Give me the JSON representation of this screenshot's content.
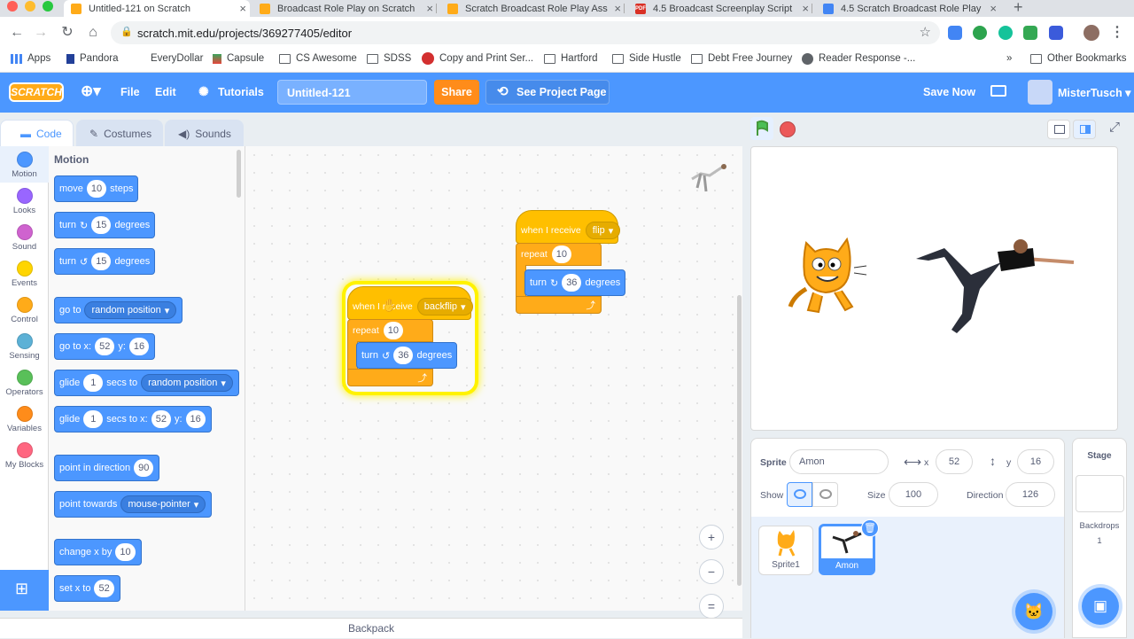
{
  "browser": {
    "tabs": [
      {
        "title": "Untitled-121 on Scratch"
      },
      {
        "title": "Broadcast Role Play on Scratch"
      },
      {
        "title": "Scratch Broadcast Role Play Ass"
      },
      {
        "title": "4.5 Broadcast Screenplay Script"
      },
      {
        "title": "4.5 Scratch Broadcast Role Play"
      }
    ],
    "tab_close": "×",
    "new_tab": "+",
    "url": "scratch.mit.edu/projects/369277405/editor",
    "bookmarks": [
      "Apps",
      "Pandora",
      "EveryDollar",
      "Capsule",
      "CS Awesome",
      "SDSS",
      "Copy and Print Ser...",
      "Hartford",
      "Side Hustle",
      "Debt Free Journey",
      "Reader Response -..."
    ],
    "other_bookmarks": "Other Bookmarks",
    "more": "»"
  },
  "menu": {
    "logo": "SCRATCH",
    "file": "File",
    "edit": "Edit",
    "tutorials": "Tutorials",
    "project_title": "Untitled-121",
    "share": "Share",
    "see_project": "See Project Page",
    "save_now": "Save Now",
    "username": "MisterTusch"
  },
  "editor_tabs": {
    "code": "Code",
    "costumes": "Costumes",
    "sounds": "Sounds"
  },
  "categories": [
    {
      "label": "Motion",
      "color": "#4c97ff"
    },
    {
      "label": "Looks",
      "color": "#9966ff"
    },
    {
      "label": "Sound",
      "color": "#cf63cf"
    },
    {
      "label": "Events",
      "color": "#ffd500"
    },
    {
      "label": "Control",
      "color": "#ffab19"
    },
    {
      "label": "Sensing",
      "color": "#5cb1d6"
    },
    {
      "label": "Operators",
      "color": "#59c059"
    },
    {
      "label": "Variables",
      "color": "#ff8c1a"
    },
    {
      "label": "My Blocks",
      "color": "#ff6680"
    }
  ],
  "palette": {
    "heading": "Motion",
    "move": {
      "pre": "move",
      "val": "10",
      "post": "steps"
    },
    "turn_right": {
      "pre": "turn",
      "val": "15",
      "post": "degrees"
    },
    "turn_left": {
      "pre": "turn",
      "val": "15",
      "post": "degrees"
    },
    "goto": {
      "pre": "go to",
      "drop": "random position"
    },
    "goto_xy": {
      "pre": "go to x:",
      "x": "52",
      "mid": "y:",
      "y": "16"
    },
    "glide": {
      "pre": "glide",
      "val": "1",
      "mid": "secs to",
      "drop": "random position"
    },
    "glide_xy": {
      "pre": "glide",
      "val": "1",
      "mid": "secs to x:",
      "x": "52",
      "mid2": "y:",
      "y": "16"
    },
    "point_dir": {
      "pre": "point in direction",
      "val": "90"
    },
    "point_towards": {
      "pre": "point towards",
      "drop": "mouse-pointer"
    },
    "change_x": {
      "pre": "change x by",
      "val": "10"
    },
    "set_x": {
      "pre": "set x to",
      "val": "52"
    }
  },
  "scripts": {
    "backflip": {
      "hat": "when I receive",
      "msg": "backflip",
      "repeat": "repeat",
      "count": "10",
      "turn": "turn",
      "deg": "36",
      "degrees": "degrees"
    },
    "flip": {
      "hat": "when I receive",
      "msg": "flip",
      "repeat": "repeat",
      "count": "10",
      "turn": "turn",
      "deg": "36",
      "degrees": "degrees"
    }
  },
  "backpack": "Backpack",
  "zoom": {
    "in": "+",
    "out": "−",
    "reset": "="
  },
  "sprite_info": {
    "sprite_label": "Sprite",
    "sprite_name": "Amon",
    "x_label": "x",
    "x": "52",
    "y_label": "y",
    "y": "16",
    "show_label": "Show",
    "size_label": "Size",
    "size": "100",
    "direction_label": "Direction",
    "direction": "126"
  },
  "sprites": [
    {
      "name": "Sprite1"
    },
    {
      "name": "Amon"
    }
  ],
  "stage_panel": {
    "title": "Stage",
    "backdrops_label": "Backdrops",
    "backdrops_count": "1"
  }
}
